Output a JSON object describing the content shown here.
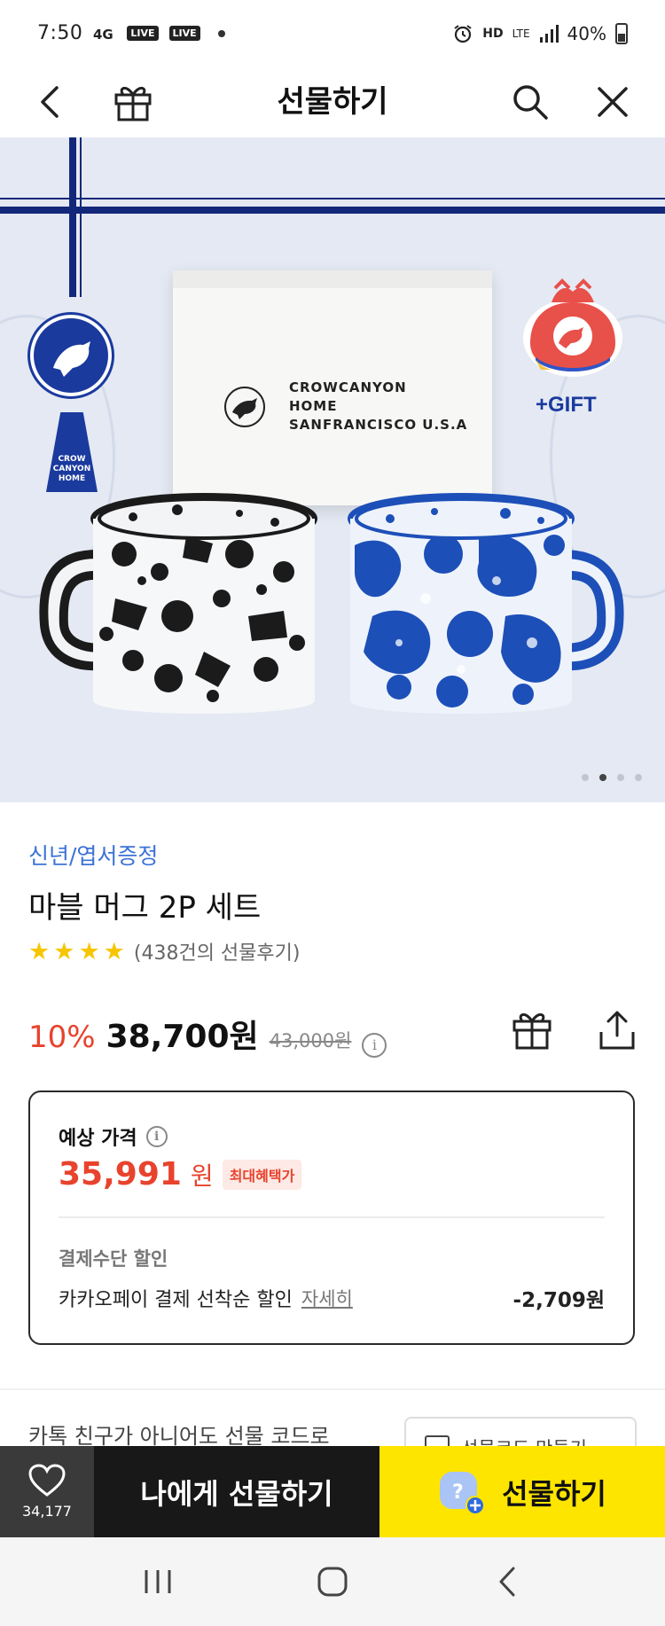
{
  "status_bar": {
    "time": "7:50",
    "live1": "LIVE",
    "live2": "LIVE",
    "hd": "HD",
    "lte": "LTE",
    "battery": "40%"
  },
  "header": {
    "title": "선물하기"
  },
  "hero": {
    "box_text": "CROWCANYON\nHOME\nSANFRANCISCO U.S.A",
    "tag_text": "CROW\nCANYON\nHOME",
    "gift_label": "+GIFT",
    "slide_count": 4,
    "active_slide": 1
  },
  "product": {
    "category": "신년/엽서증정",
    "title": "마블 머그 2P 세트",
    "rating_stars": 4,
    "review_text": "(438건의 선물후기)",
    "discount": "10%",
    "price": "38,700원",
    "original_price": "43,000원",
    "info_icon": "i"
  },
  "estimate": {
    "label": "예상 가격",
    "price": "35,991",
    "unit": "원",
    "badge": "최대혜택가",
    "payment_label": "결제수단 할인",
    "payment_desc": "카카오페이 결제 선착순 할인",
    "payment_detail": "자세히",
    "payment_amount": "-2,709원"
  },
  "gift_code": {
    "text": "카톡 친구가 아니어도 선물 코드로",
    "button": "선물코드 만들기"
  },
  "bottom_bar": {
    "like_count": "34,177",
    "self_gift": "나에게 선물하기",
    "gift": "선물하기"
  },
  "colors": {
    "accent_red": "#e8432d",
    "kakao_yellow": "#fee500",
    "category_blue": "#3c73d6",
    "ribbon_navy": "#13287a"
  }
}
